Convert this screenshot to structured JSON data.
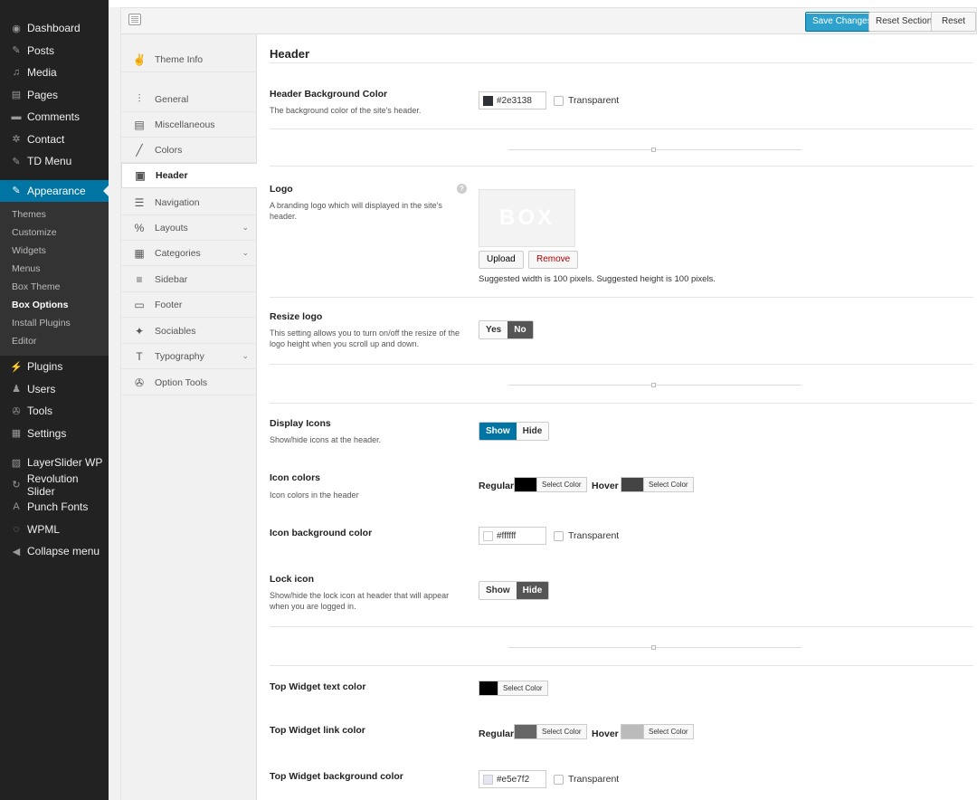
{
  "admin_menu": {
    "items_top": [
      {
        "label": "Dashboard",
        "icon": "dashboard-icon",
        "glyph": "◉"
      },
      {
        "label": "Posts",
        "icon": "pin-icon",
        "glyph": "✎"
      },
      {
        "label": "Media",
        "icon": "media-icon",
        "glyph": "♫"
      },
      {
        "label": "Pages",
        "icon": "pages-icon",
        "glyph": "▤"
      },
      {
        "label": "Comments",
        "icon": "comments-icon",
        "glyph": "▬"
      },
      {
        "label": "Contact",
        "icon": "gear-icon",
        "glyph": "✲"
      },
      {
        "label": "TD Menu",
        "icon": "pin-icon",
        "glyph": "✎"
      }
    ],
    "active": {
      "label": "Appearance",
      "icon": "brush-icon",
      "glyph": "✎"
    },
    "submenu": [
      "Themes",
      "Customize",
      "Widgets",
      "Menus",
      "Box Theme",
      "Box Options",
      "Install Plugins",
      "Editor"
    ],
    "items_bottom": [
      {
        "label": "Plugins",
        "icon": "plug-icon",
        "glyph": "⚡"
      },
      {
        "label": "Users",
        "icon": "user-icon",
        "glyph": "♟"
      },
      {
        "label": "Tools",
        "icon": "wrench-icon",
        "glyph": "✇"
      },
      {
        "label": "Settings",
        "icon": "settings-icon",
        "glyph": "▦"
      },
      {
        "label": "LayerSlider WP",
        "icon": "image-icon",
        "glyph": "▨"
      },
      {
        "label": "Revolution Slider",
        "icon": "refresh-icon",
        "glyph": "↻"
      },
      {
        "label": "Punch Fonts",
        "icon": "font-icon",
        "glyph": "A"
      },
      {
        "label": "WPML",
        "icon": "wpml-icon",
        "glyph": "◌"
      },
      {
        "label": "Collapse menu",
        "icon": "collapse-icon",
        "glyph": "◀"
      }
    ]
  },
  "toolbar": {
    "save": "Save Changes",
    "reset_section": "Reset Section",
    "reset_all": "Reset All"
  },
  "sidenav": [
    {
      "label": "Theme Info",
      "icon": "rock-hand-icon",
      "glyph": "✌",
      "chevron": false
    },
    {
      "label": "General",
      "icon": "sliders-icon",
      "glyph": "⫶",
      "chevron": false
    },
    {
      "label": "Miscellaneous",
      "icon": "window-icon",
      "glyph": "▤",
      "chevron": false
    },
    {
      "label": "Colors",
      "icon": "brush-icon",
      "glyph": "╱",
      "chevron": false
    },
    {
      "label": "Header",
      "icon": "header-icon",
      "glyph": "▣",
      "chevron": false
    },
    {
      "label": "Navigation",
      "icon": "list-icon",
      "glyph": "☰",
      "chevron": false
    },
    {
      "label": "Layouts",
      "icon": "percent-icon",
      "glyph": "%",
      "chevron": true
    },
    {
      "label": "Categories",
      "icon": "grid-icon",
      "glyph": "▦",
      "chevron": true
    },
    {
      "label": "Sidebar",
      "icon": "menu-icon",
      "glyph": "≡",
      "chevron": false
    },
    {
      "label": "Footer",
      "icon": "footer-icon",
      "glyph": "▭",
      "chevron": false
    },
    {
      "label": "Sociables",
      "icon": "twitter-icon",
      "glyph": "✦",
      "chevron": false
    },
    {
      "label": "Typography",
      "icon": "text-icon",
      "glyph": "T",
      "chevron": true
    },
    {
      "label": "Option Tools",
      "icon": "wrench-icon",
      "glyph": "✇",
      "chevron": false
    }
  ],
  "panel": {
    "title": "Header",
    "header_bg": {
      "title": "Header Background Color",
      "desc": "The background color of the site's header.",
      "value": "#2e3138",
      "transparent": "Transparent"
    },
    "logo": {
      "title": "Logo",
      "desc": "A branding logo which will displayed in the site's header.",
      "logo_text": "BOX",
      "upload": "Upload",
      "remove": "Remove",
      "hint": "Suggested width is 100 pixels. Suggested height is 100 pixels."
    },
    "resize_logo": {
      "title": "Resize logo",
      "desc": "This setting allows you to turn on/off the resize of the logo height when you scroll up and down.",
      "yes": "Yes",
      "no": "No"
    },
    "display_icons": {
      "title": "Display Icons",
      "desc": "Show/hide icons at the header.",
      "show": "Show",
      "hide": "Hide"
    },
    "icon_colors": {
      "title": "Icon colors",
      "desc": "Icon colors in the header",
      "regular": "Regular",
      "hover": "Hover",
      "select": "Select Color",
      "regular_color": "#000000",
      "hover_color": "#444444"
    },
    "icon_bg": {
      "title": "Icon background color",
      "value": "#ffffff",
      "transparent": "Transparent"
    },
    "lock_icon": {
      "title": "Lock icon",
      "desc": "Show/hide the lock icon at header that will appear when you are logged in.",
      "show": "Show",
      "hide": "Hide"
    },
    "tw_text": {
      "title": "Top Widget text color",
      "select": "Select Color",
      "color": "#000000"
    },
    "tw_link": {
      "title": "Top Widget link color",
      "regular": "Regular",
      "hover": "Hover",
      "select": "Select Color",
      "regular_color": "#666666",
      "hover_color": "#bbbbbb"
    },
    "tw_bg": {
      "title": "Top Widget background color",
      "value": "#e5e7f2",
      "transparent": "Transparent"
    }
  }
}
